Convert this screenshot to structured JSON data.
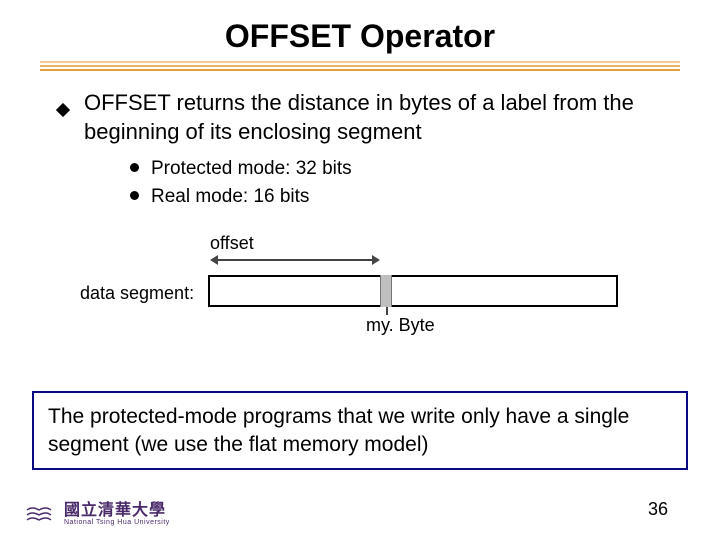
{
  "title": "OFFSET Operator",
  "main_bullet": "OFFSET returns the distance in bytes of a label from the beginning of its enclosing segment",
  "sub_bullets": [
    "Protected mode: 32 bits",
    "Real mode: 16 bits"
  ],
  "diagram": {
    "offset_label": "offset",
    "segment_label": "data segment:",
    "mybyte_label": "my. Byte"
  },
  "note": "The protected-mode programs that we write only have a single segment (we use the flat memory model)",
  "footer": {
    "uni_cn": "國立清華大學",
    "uni_en": "National Tsing Hua University"
  },
  "page_number": "36"
}
